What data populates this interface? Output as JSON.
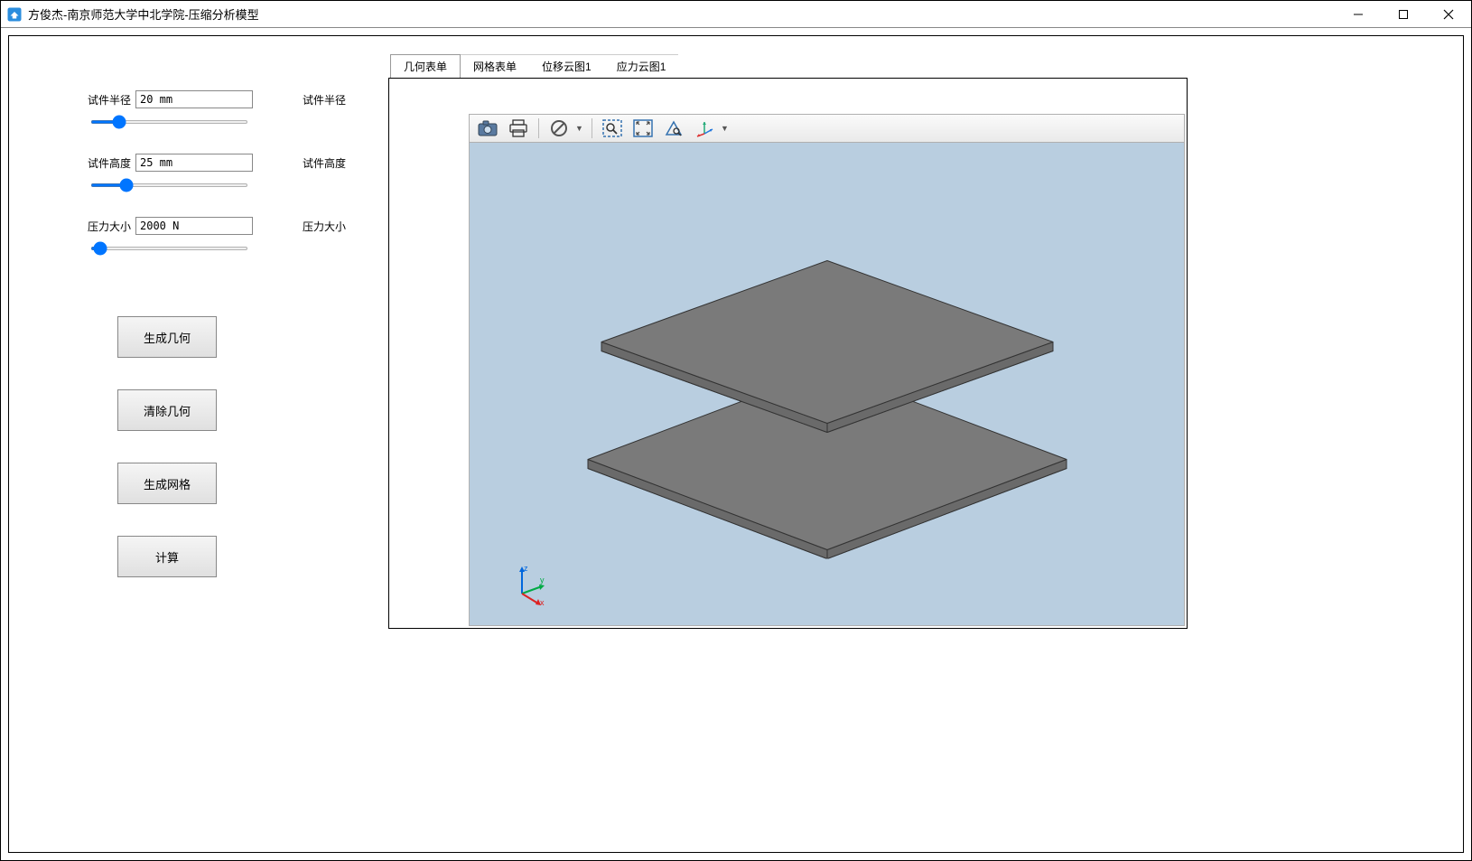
{
  "window": {
    "title": "方俊杰-南京师范大学中北学院-压缩分析模型"
  },
  "params": {
    "radius": {
      "label": "试件半径",
      "value": "20 mm",
      "right_label": "试件半径",
      "slider_val": 15
    },
    "height": {
      "label": "试件高度",
      "value": "25 mm",
      "right_label": "试件高度",
      "slider_val": 20
    },
    "pressure": {
      "label": "压力大小",
      "value": "2000 N",
      "right_label": "压力大小",
      "slider_val": 2
    }
  },
  "buttons": {
    "gen_geom": "生成几何",
    "clear_geom": "清除几何",
    "gen_mesh": "生成网格",
    "compute": "计算"
  },
  "tabs": [
    "几何表单",
    "网格表单",
    "位移云图1",
    "应力云图1"
  ],
  "active_tab": 0,
  "toolbar_icons": [
    "camera-icon",
    "print-icon",
    "cancel-icon",
    "zoom-box-icon",
    "zoom-extent-icon",
    "zoom-select-icon",
    "axis-orient-icon"
  ],
  "axis_labels": {
    "x": "x",
    "y": "y",
    "z": "z"
  }
}
